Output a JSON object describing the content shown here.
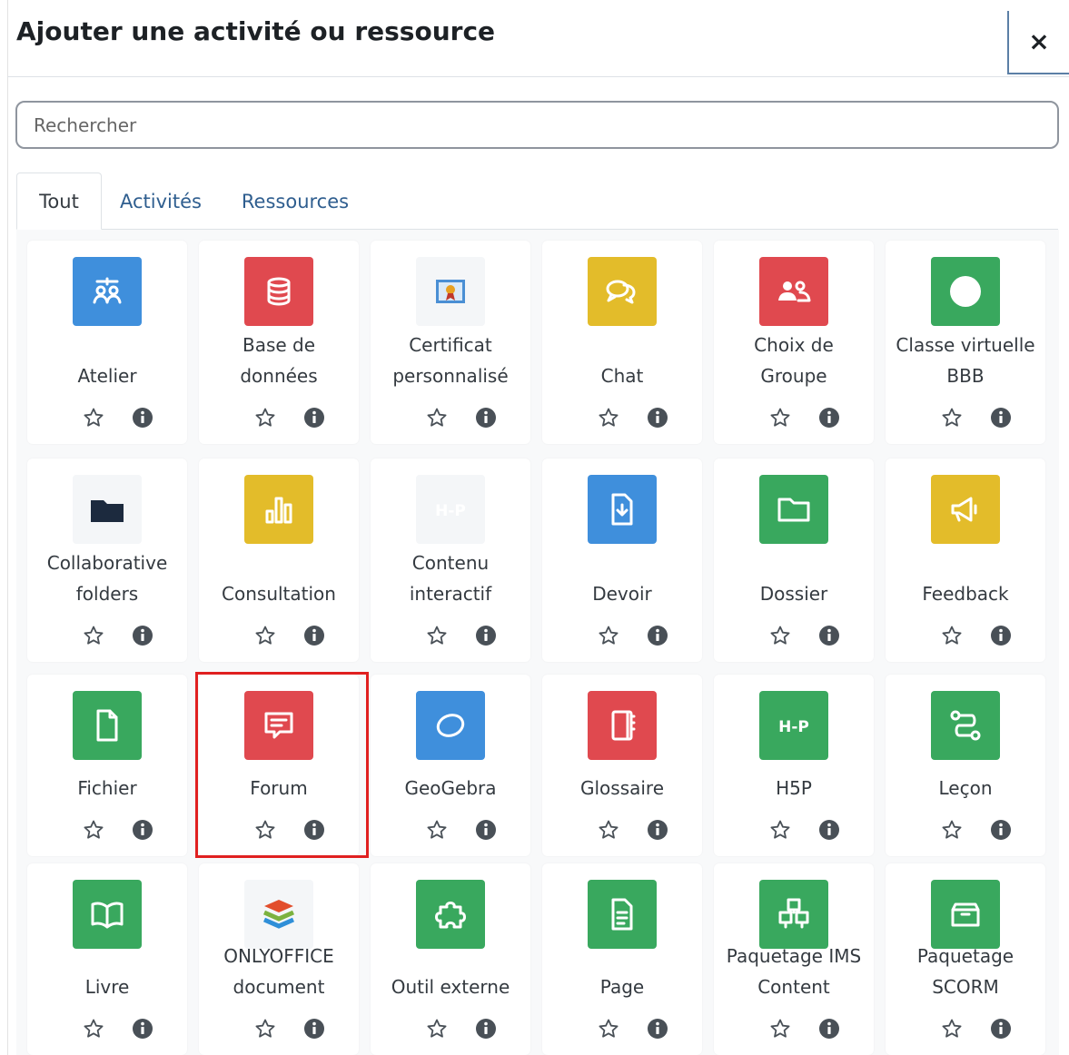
{
  "modal": {
    "title": "Ajouter une activité ou ressource",
    "close": "×"
  },
  "search": {
    "placeholder": "Rechercher",
    "value": ""
  },
  "tabs": [
    {
      "label": "Tout",
      "active": true
    },
    {
      "label": "Activités",
      "active": false
    },
    {
      "label": "Ressources",
      "active": false
    }
  ],
  "colors": {
    "blue": "#3f8fdc",
    "red": "#e0494f",
    "yellow": "#e3bc2a",
    "green": "#39a85e",
    "highlight": "#e02020",
    "link": "#2f5e8f"
  },
  "items": [
    {
      "line1": "",
      "line2": "Atelier",
      "icon": "workshop-icon",
      "color": "#3f8fdc"
    },
    {
      "line1": "Base de",
      "line2": "données",
      "icon": "database-icon",
      "color": "#e0494f"
    },
    {
      "line1": "Certificat",
      "line2": "personnalisé",
      "icon": "certificate-icon",
      "color": ""
    },
    {
      "line1": "",
      "line2": "Chat",
      "icon": "chat-icon",
      "color": "#e3bc2a"
    },
    {
      "line1": "Choix de",
      "line2": "Groupe",
      "icon": "group-choice-icon",
      "color": "#e0494f"
    },
    {
      "line1": "Classe virtuelle",
      "line2": "BBB",
      "icon": "bigbluebutton-icon",
      "color": "#39a85e"
    },
    {
      "line1": "Collaborative",
      "line2": "folders",
      "icon": "folder-dark-icon",
      "color": ""
    },
    {
      "line1": "",
      "line2": "Consultation",
      "icon": "bar-chart-icon",
      "color": "#e3bc2a"
    },
    {
      "line1": "Contenu",
      "line2": "interactif",
      "icon": "h5p-icon",
      "color": ""
    },
    {
      "line1": "",
      "line2": "Devoir",
      "icon": "assignment-icon",
      "color": "#3f8fdc"
    },
    {
      "line1": "",
      "line2": "Dossier",
      "icon": "folder-icon",
      "color": "#39a85e"
    },
    {
      "line1": "",
      "line2": "Feedback",
      "icon": "megaphone-icon",
      "color": "#e3bc2a"
    },
    {
      "line1": "",
      "line2": "Fichier",
      "icon": "file-icon",
      "color": "#39a85e"
    },
    {
      "line1": "",
      "line2": "Forum",
      "icon": "forum-icon",
      "color": "#e0494f"
    },
    {
      "line1": "",
      "line2": "GeoGebra",
      "icon": "geogebra-icon",
      "color": "#3f8fdc"
    },
    {
      "line1": "",
      "line2": "Glossaire",
      "icon": "glossary-icon",
      "color": "#e0494f"
    },
    {
      "line1": "",
      "line2": "H5P",
      "icon": "h5p-icon",
      "color": "#39a85e"
    },
    {
      "line1": "",
      "line2": "Leçon",
      "icon": "lesson-icon",
      "color": "#39a85e"
    },
    {
      "line1": "",
      "line2": "Livre",
      "icon": "book-icon",
      "color": "#39a85e"
    },
    {
      "line1": "ONLYOFFICE",
      "line2": "document",
      "icon": "onlyoffice-icon",
      "color": ""
    },
    {
      "line1": "",
      "line2": "Outil externe",
      "icon": "puzzle-icon",
      "color": "#39a85e"
    },
    {
      "line1": "",
      "line2": "Page",
      "icon": "page-icon",
      "color": "#39a85e"
    },
    {
      "line1": "Paquetage IMS",
      "line2": "Content",
      "icon": "ims-package-icon",
      "color": "#39a85e"
    },
    {
      "line1": "Paquetage",
      "line2": "SCORM",
      "icon": "scorm-icon",
      "color": "#39a85e"
    }
  ],
  "actions": {
    "star": "☆",
    "info": "i"
  }
}
